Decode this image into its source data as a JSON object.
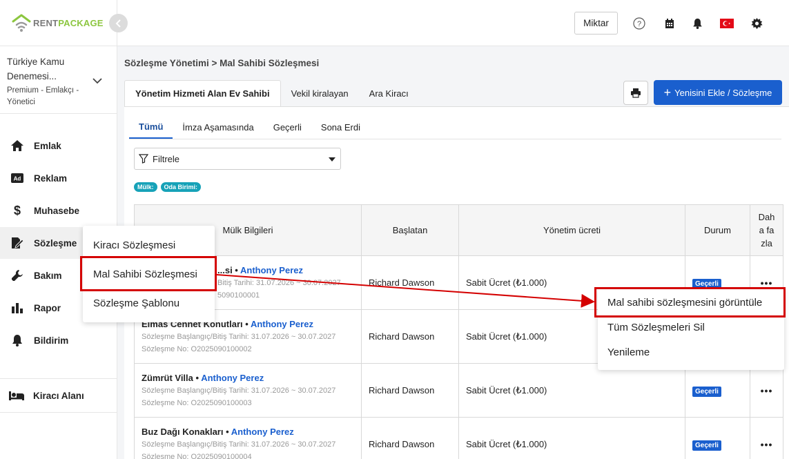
{
  "brand": {
    "part1": "RENT",
    "part2": "PACKAGE"
  },
  "account": {
    "name_line1": "Türkiye Kamu",
    "name_line2": "Denemesi...",
    "role_line1": "Premium - Emlakçı -",
    "role_line2": "Yönetici"
  },
  "nav": {
    "items": [
      {
        "label": "Emlak",
        "icon": "home-icon"
      },
      {
        "label": "Reklam",
        "icon": "ad-icon"
      },
      {
        "label": "Muhasebe",
        "icon": "dollar-icon"
      },
      {
        "label": "Sözleşme",
        "icon": "contract-icon"
      },
      {
        "label": "Bakım",
        "icon": "wrench-icon"
      },
      {
        "label": "Rapor",
        "icon": "chart-icon"
      },
      {
        "label": "Bildirim",
        "icon": "bell-icon"
      }
    ],
    "tenant_area": "Kiracı Alanı"
  },
  "topbar": {
    "miktar": "Miktar",
    "accent": "#1a5fce"
  },
  "breadcrumb": "Sözleşme Yönetimi > Mal Sahibi Sözleşmesi",
  "tabs": [
    "Yönetim Hizmeti Alan Ev Sahibi",
    "Vekil kiralayan",
    "Ara Kiracı"
  ],
  "add_button": "Yenisini Ekle / Sözleşme",
  "subtabs": [
    "Tümü",
    "İmza Aşamasında",
    "Geçerli",
    "Sona Erdi"
  ],
  "filter": {
    "label": "Filtrele"
  },
  "chips": [
    "Mülk:",
    "Oda Birimi:"
  ],
  "table": {
    "headers": [
      "Mülk Bilgileri",
      "Başlatan",
      "Yönetim ücreti",
      "Durum",
      "Daha fazla"
    ],
    "header_more_lines": [
      "Dah",
      "a fa",
      "zla"
    ],
    "rows": [
      {
        "title": "...si",
        "owner": "Anthony Perez",
        "dates": "Sözleşme Başlangıç/Bitiş Tarihi: 31.07.2026 ~ 30.07.2027",
        "no": "Sözleşme No: O2025090100001",
        "dates_visible": "Bitiş Tarihi: 31.07.2026 ~ 30.07.2027",
        "no_visible": "5090100001",
        "initiator": "Richard Dawson",
        "fee": "Sabit Ücret (₺1.000)",
        "status": "Geçerli"
      },
      {
        "title": "Elmas Cennet Konutları",
        "owner": "Anthony Perez",
        "dates": "Sözleşme Başlangıç/Bitiş Tarihi: 31.07.2026 ~ 30.07.2027",
        "no": "Sözleşme No: O2025090100002",
        "initiator": "Richard Dawson",
        "fee": "Sabit Ücret (₺1.000)",
        "status": ""
      },
      {
        "title": "Zümrüt Villa",
        "owner": "Anthony Perez",
        "dates": "Sözleşme Başlangıç/Bitiş Tarihi: 31.07.2026 ~ 30.07.2027",
        "no": "Sözleşme No: O2025090100003",
        "initiator": "Richard Dawson",
        "fee": "Sabit Ücret (₺1.000)",
        "status": "Geçerli"
      },
      {
        "title": "Buz Dağı Konakları",
        "owner": "Anthony Perez",
        "dates": "Sözleşme Başlangıç/Bitiş Tarihi: 31.07.2026 ~ 30.07.2027",
        "no": "Sözleşme No: O2025090100004",
        "initiator": "Richard Dawson",
        "fee": "Sabit Ücret (₺1.000)",
        "status": "Geçerli"
      }
    ]
  },
  "contract_menu": [
    "Kiracı Sözleşmesi",
    "Mal Sahibi Sözleşmesi",
    "Sözleşme Şablonu"
  ],
  "row_menu": [
    "Mal sahibi sözleşmesini görüntüle",
    "Tüm Sözleşmeleri Sil",
    "Yenileme"
  ],
  "highlight_color": "#d40000"
}
